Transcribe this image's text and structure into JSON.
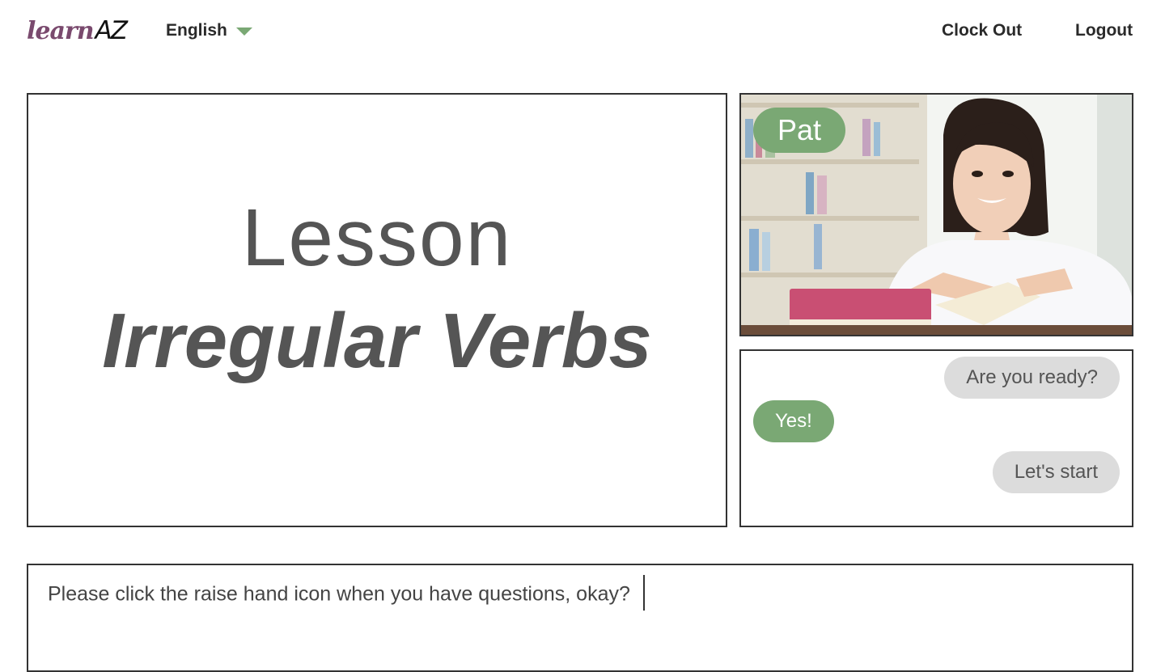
{
  "header": {
    "logo_learn": "learn",
    "logo_az": "AZ",
    "language": "English",
    "clock_out": "Clock Out",
    "logout": "Logout"
  },
  "lesson": {
    "label": "Lesson",
    "title": "Irregular Verbs"
  },
  "video": {
    "participant_name": "Pat"
  },
  "chat": {
    "messages": [
      {
        "text": "Are you ready?",
        "side": "right"
      },
      {
        "text": "Yes!",
        "side": "left"
      },
      {
        "text": "Let's start",
        "side": "right"
      }
    ]
  },
  "message_input": {
    "value": "Please click the raise hand icon when you have questions, okay?"
  },
  "colors": {
    "accent_green": "#7aa874",
    "logo_purple": "#7a4a6e",
    "bubble_grey": "#dcdcdc",
    "text_dark": "#555555"
  }
}
